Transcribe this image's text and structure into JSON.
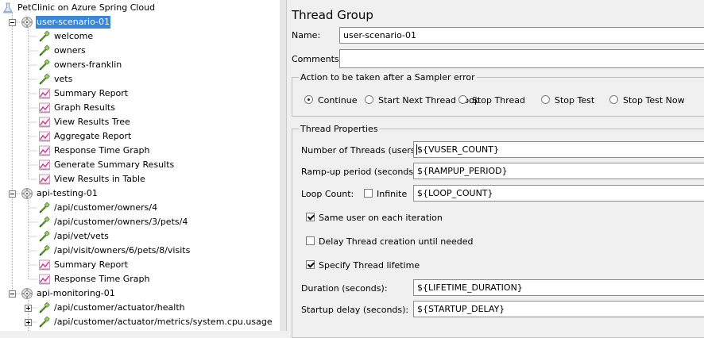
{
  "tree": {
    "root": {
      "label": "PetClinic on Azure Spring Cloud",
      "icon": "test-plan-flask-icon"
    },
    "groups": [
      {
        "label": "user-scenario-01",
        "selected": true,
        "expanded": true,
        "children": [
          {
            "label": "welcome",
            "icon": "http-sampler-pipette-icon"
          },
          {
            "label": "owners",
            "icon": "http-sampler-pipette-icon"
          },
          {
            "label": "owners-franklin",
            "icon": "http-sampler-pipette-icon"
          },
          {
            "label": "vets",
            "icon": "http-sampler-pipette-icon"
          },
          {
            "label": "Summary Report",
            "icon": "listener-graph-icon"
          },
          {
            "label": "Graph Results",
            "icon": "listener-graph-icon"
          },
          {
            "label": "View Results Tree",
            "icon": "listener-graph-icon"
          },
          {
            "label": "Aggregate Report",
            "icon": "listener-graph-icon"
          },
          {
            "label": "Response Time Graph",
            "icon": "listener-graph-icon"
          },
          {
            "label": "Generate Summary Results",
            "icon": "listener-graph-icon"
          },
          {
            "label": "View Results in Table",
            "icon": "listener-graph-icon"
          }
        ]
      },
      {
        "label": "api-testing-01",
        "selected": false,
        "expanded": true,
        "children": [
          {
            "label": "/api/customer/owners/4",
            "icon": "http-sampler-pipette-icon"
          },
          {
            "label": "/api/customer/owners/3/pets/4",
            "icon": "http-sampler-pipette-icon"
          },
          {
            "label": "/api/vet/vets",
            "icon": "http-sampler-pipette-icon"
          },
          {
            "label": "/api/visit/owners/6/pets/8/visits",
            "icon": "http-sampler-pipette-icon"
          },
          {
            "label": "Summary Report",
            "icon": "listener-graph-icon"
          },
          {
            "label": "Response Time Graph",
            "icon": "listener-graph-icon"
          }
        ]
      },
      {
        "label": "api-monitoring-01",
        "selected": false,
        "expanded": true,
        "children": [
          {
            "label": "/api/customer/actuator/health",
            "icon": "http-sampler-pipette-icon",
            "collapsed": true
          },
          {
            "label": "/api/customer/actuator/metrics/system.cpu.usage",
            "icon": "http-sampler-pipette-icon",
            "collapsed": true
          }
        ]
      }
    ]
  },
  "panel": {
    "title": "Thread Group",
    "name_label": "Name:",
    "name_value": "user-scenario-01",
    "comments_label": "Comments:",
    "comments_value": "",
    "error_group": {
      "legend": "Action to be taken after a Sampler error",
      "options": [
        {
          "label": "Continue",
          "selected": true
        },
        {
          "label": "Start Next Thread Loop",
          "selected": false
        },
        {
          "label": "Stop Thread",
          "selected": false
        },
        {
          "label": "Stop Test",
          "selected": false
        },
        {
          "label": "Stop Test Now",
          "selected": false
        }
      ]
    },
    "thread_props": {
      "legend": "Thread Properties",
      "threads_label": "Number of Threads (users):",
      "threads_value": "${VUSER_COUNT}",
      "rampup_label": "Ramp-up period (seconds):",
      "rampup_value": "${RAMPUP_PERIOD}",
      "loop_label": "Loop Count:",
      "infinite_label": "Infinite",
      "infinite_checked": false,
      "loop_value": "${LOOP_COUNT}",
      "same_user_label": "Same user on each iteration",
      "same_user_checked": true,
      "delay_label": "Delay Thread creation until needed",
      "delay_checked": false,
      "lifetime_label": "Specify Thread lifetime",
      "lifetime_checked": true,
      "duration_label": "Duration (seconds):",
      "duration_value": "${LIFETIME_DURATION}",
      "startup_label": "Startup delay (seconds):",
      "startup_value": "${STARTUP_DELAY}"
    }
  }
}
